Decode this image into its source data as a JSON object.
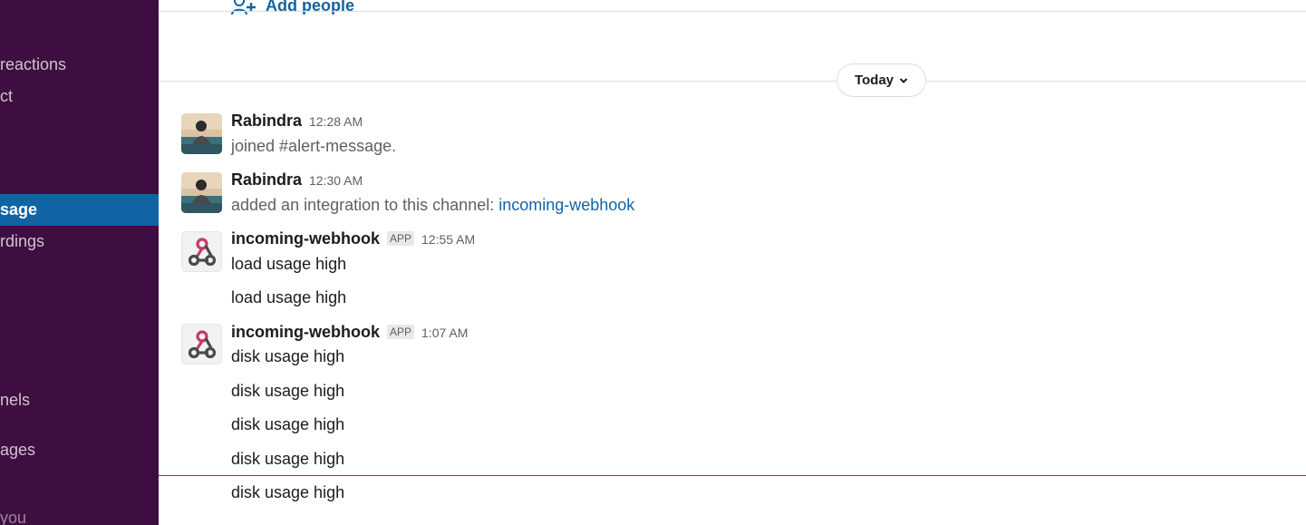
{
  "sidebar": {
    "items": [
      {
        "label": "reactions",
        "state": "normal"
      },
      {
        "label": "ct",
        "state": "normal"
      },
      {
        "label": "sage",
        "state": "active"
      },
      {
        "label": "rdings",
        "state": "normal"
      },
      {
        "label": "nels",
        "state": "normal"
      },
      {
        "label": "ages",
        "state": "normal"
      },
      {
        "label": "you",
        "state": "dim"
      }
    ]
  },
  "header": {
    "add_people_label": "Add people"
  },
  "day_divider": {
    "label": "Today",
    "icon": "chevron-down-icon"
  },
  "messages": [
    {
      "sender": "Rabindra",
      "time": "12:28 AM",
      "avatar": "user-photo",
      "lines": [
        "joined #alert-message."
      ]
    },
    {
      "sender": "Rabindra",
      "time": "12:30 AM",
      "avatar": "user-photo",
      "text_prefix": "added an integration to this channel: ",
      "link": "incoming-webhook"
    },
    {
      "sender": "incoming-webhook",
      "badge": "APP",
      "time": "12:55 AM",
      "avatar": "webhook-icon",
      "lines": [
        "load usage high",
        "load usage high"
      ]
    },
    {
      "sender": "incoming-webhook",
      "badge": "APP",
      "time": "1:07 AM",
      "avatar": "webhook-icon",
      "lines": [
        "disk usage high",
        "disk usage high",
        "disk usage high",
        "disk usage high",
        "disk usage high"
      ]
    }
  ],
  "colors": {
    "sidebar_bg": "#3f0e40",
    "active_item": "#1164a3",
    "link": "#1264a3",
    "new_messages_line": "#8b2b6e"
  }
}
